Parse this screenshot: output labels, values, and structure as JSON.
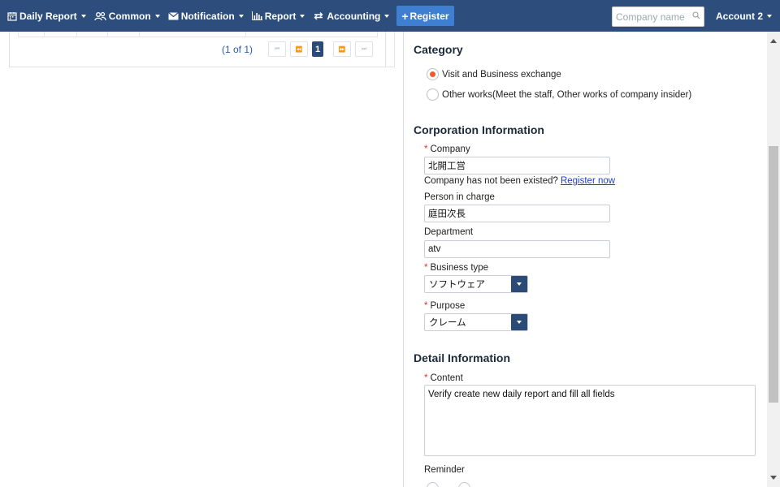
{
  "nav": {
    "items": [
      {
        "label": "Daily Report",
        "icon": "calendar-icon"
      },
      {
        "label": "Common",
        "icon": "users-icon"
      },
      {
        "label": "Notification",
        "icon": "envelope-icon"
      },
      {
        "label": "Report",
        "icon": "bar-chart-icon"
      },
      {
        "label": "Accounting",
        "icon": "exchange-icon"
      }
    ],
    "register_label": "Register",
    "search_placeholder": "Company name",
    "account_label": "Account 2"
  },
  "pager": {
    "report": "(1 of 1)",
    "current_page": "1",
    "first": "⏮",
    "prev": "⏪",
    "next": "⏩",
    "last": "⏭"
  },
  "category": {
    "title": "Category",
    "options": [
      {
        "label": "Visit and Business exchange",
        "selected": true
      },
      {
        "label": "Other works(Meet the staff, Other works of company insider)",
        "selected": false
      }
    ]
  },
  "corporation": {
    "title": "Corporation Information",
    "company_label": "Company",
    "company_value": "北開工営",
    "company_hint": "Company has not been existed?",
    "register_now": "Register now",
    "person_label": "Person in charge",
    "person_value": "庭田次長",
    "department_label": "Department",
    "department_value": "atv",
    "business_type_label": "Business type",
    "business_type_value": "ソフトウェア",
    "purpose_label": "Purpose",
    "purpose_value": "クレーム"
  },
  "detail": {
    "title": "Detail Information",
    "content_label": "Content",
    "content_value": "Verify create new daily report and fill all fields",
    "reminder_label": "Reminder"
  },
  "required_mark": "*",
  "colors": {
    "navbar": "#2d4e7c",
    "register_button": "#3f7fd1",
    "radio_selected": "#ef5b2a",
    "required": "#e0342f",
    "link": "#1d3fcf"
  }
}
